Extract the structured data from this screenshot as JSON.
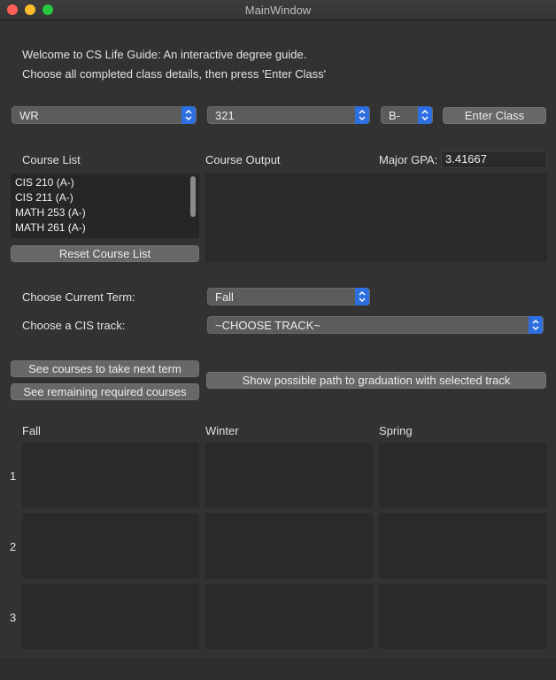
{
  "window": {
    "title": "MainWindow"
  },
  "intro": {
    "line1": "Welcome to CS Life Guide: An interactive degree guide.",
    "line2": "Choose all completed class details, then press 'Enter Class'"
  },
  "class_entry": {
    "subject_value": "WR",
    "number_value": "321",
    "grade_value": "B-",
    "enter_button": "Enter Class"
  },
  "course_list": {
    "label": "Course List",
    "items": [
      "CIS 210  (A-)",
      "CIS 211  (A-)",
      "MATH 253  (A-)",
      "MATH 261  (A-)"
    ],
    "reset_button": "Reset Course List"
  },
  "course_output": {
    "label": "Course Output"
  },
  "gpa": {
    "label": "Major GPA:",
    "value": "3.41667"
  },
  "term": {
    "label": "Choose Current Term:",
    "value": "Fall"
  },
  "track": {
    "label": "Choose a CIS track:",
    "value": "~CHOOSE TRACK~"
  },
  "actions": {
    "next_term_button": "See courses to take next term",
    "remaining_button": "See remaining required courses",
    "path_button": "Show possible path to graduation with selected track"
  },
  "grid": {
    "columns": [
      "Fall",
      "Winter",
      "Spring"
    ],
    "rows": [
      "1",
      "2",
      "3"
    ]
  },
  "colors": {
    "accent": "#2d6fe0",
    "window_bg": "#323232"
  }
}
